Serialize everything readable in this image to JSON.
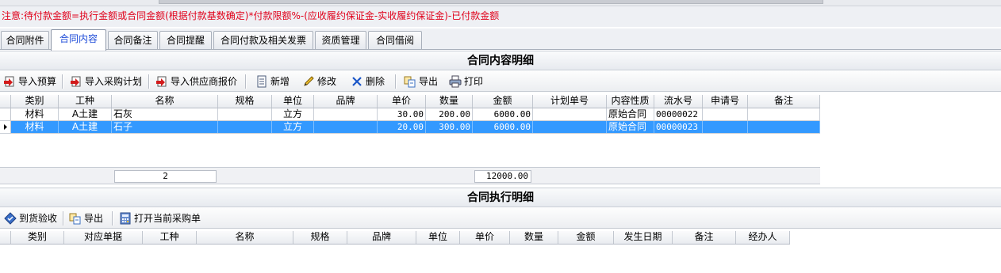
{
  "notice": "注意:待付款金额=执行金额或合同金额(根据付款基数确定)*付款限额%-(应收履约保证金-实收履约保证金)-已付款金额",
  "tabs": [
    {
      "label": "合同附件",
      "active": false
    },
    {
      "label": "合同内容",
      "active": true
    },
    {
      "label": "合同备注",
      "active": false
    },
    {
      "label": "合同提醒",
      "active": false
    },
    {
      "label": "合同付款及相关发票",
      "active": false
    },
    {
      "label": "资质管理",
      "active": false
    },
    {
      "label": "合同借阅",
      "active": false
    }
  ],
  "content_section": {
    "title": "合同内容明细",
    "toolbar": {
      "import_budget": "导入预算",
      "import_purchase_plan": "导入采购计划",
      "import_supplier_quote": "导入供应商报价",
      "add": "新增",
      "edit": "修改",
      "delete": "删除",
      "export": "导出",
      "print": "打印"
    },
    "columns": [
      "类别",
      "工种",
      "名称",
      "规格",
      "单位",
      "品牌",
      "单价",
      "数量",
      "金额",
      "计划单号",
      "内容性质",
      "流水号",
      "申请号",
      "备注"
    ],
    "rows": [
      {
        "category": "材料",
        "trade": "A土建",
        "name": "石灰",
        "spec": "",
        "unit": "立方",
        "brand": "",
        "price": "30.00",
        "qty": "200.00",
        "amount": "6000.00",
        "plan_no": "",
        "nature": "原始合同",
        "serial": "00000022",
        "apply_no": "",
        "remark": "",
        "selected": false
      },
      {
        "category": "材料",
        "trade": "A土建",
        "name": "石子",
        "spec": "",
        "unit": "立方",
        "brand": "",
        "price": "20.00",
        "qty": "300.00",
        "amount": "6000.00",
        "plan_no": "",
        "nature": "原始合同",
        "serial": "00000023",
        "apply_no": "",
        "remark": "",
        "selected": true
      }
    ],
    "footer": {
      "count": "2",
      "total": "12000.00"
    }
  },
  "execution_section": {
    "title": "合同执行明细",
    "toolbar": {
      "receive_check": "到货验收",
      "export": "导出",
      "open_purchase_order": "打开当前采购单"
    },
    "columns": [
      "类别",
      "对应单据",
      "工种",
      "名称",
      "规格",
      "品牌",
      "单位",
      "单价",
      "数量",
      "金额",
      "发生日期",
      "备注",
      "经办人"
    ]
  },
  "colors": {
    "notice_text": "#e0001a",
    "active_tab_text": "#1d4bd8",
    "selection": "#3399ff"
  }
}
